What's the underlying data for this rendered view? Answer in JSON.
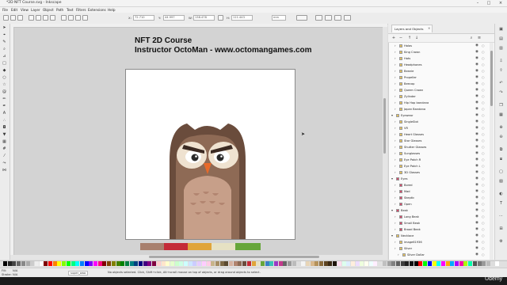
{
  "window": {
    "title": "*2D NFT Course.svg - Inkscape"
  },
  "menu": [
    "File",
    "Edit",
    "View",
    "Layer",
    "Object",
    "Path",
    "Text",
    "Filters",
    "Extensions",
    "Help"
  ],
  "toolbar": {
    "x_label": "X:",
    "x_value": "72.710",
    "y_label": "Y:",
    "y_value": "44.997",
    "w_label": "W:",
    "w_value": "138.478",
    "h_label": "H:",
    "h_value": "111.443",
    "unit": "mm"
  },
  "canvas": {
    "line1": "NFT 2D Course",
    "line2": "Instructor OctoMan - www.octomangames.com"
  },
  "palette_swatches": [
    {
      "name": "Brown",
      "color": "#a8806e"
    },
    {
      "name": "Red",
      "color": "#c42b37"
    },
    {
      "name": "Orange",
      "color": "#e0a43a"
    },
    {
      "name": "Cream",
      "color": "#e6e1c3"
    },
    {
      "name": "Green",
      "color": "#67a63a"
    }
  ],
  "panel": {
    "tab": "Layers and Objects",
    "close_glyph": "×"
  },
  "layers": [
    {
      "name": "Halos",
      "depth": 2,
      "color": "#e7c35b"
    },
    {
      "name": "King Crown",
      "depth": 2,
      "color": "#e7c35b"
    },
    {
      "name": "Hats",
      "depth": 2,
      "color": "#e7c35b"
    },
    {
      "name": "Headphones",
      "depth": 2,
      "color": "#e7c35b"
    },
    {
      "name": "Beanie",
      "depth": 2,
      "color": "#e7c35b"
    },
    {
      "name": "Propeller",
      "depth": 2,
      "color": "#e7c35b"
    },
    {
      "name": "Beecap",
      "depth": 2,
      "color": "#e7c35b"
    },
    {
      "name": "Queen Crown",
      "depth": 2,
      "color": "#e7c35b"
    },
    {
      "name": "Zylinder",
      "depth": 2,
      "color": "#e7c35b"
    },
    {
      "name": "Hip Hop bandana",
      "depth": 2,
      "color": "#e7c35b"
    },
    {
      "name": "Japan Bandana",
      "depth": 2,
      "color": "#e7c35b"
    },
    {
      "name": "Eyewear",
      "depth": 1,
      "color": "#e7c35b"
    },
    {
      "name": "SingleSlot",
      "depth": 2,
      "color": "#e7c35b"
    },
    {
      "name": "VR",
      "depth": 2,
      "color": "#e7c35b"
    },
    {
      "name": "Heart Glasses",
      "depth": 2,
      "color": "#e7c35b"
    },
    {
      "name": "Star Glasses",
      "depth": 2,
      "color": "#e7c35b"
    },
    {
      "name": "Shutter Glasses",
      "depth": 2,
      "color": "#e7c35b"
    },
    {
      "name": "Sunglasses",
      "depth": 2,
      "color": "#e7c35b"
    },
    {
      "name": "Eye Patch R",
      "depth": 2,
      "color": "#e7c35b"
    },
    {
      "name": "Eye Patch L",
      "depth": 2,
      "color": "#e7c35b"
    },
    {
      "name": "3D Glasses",
      "depth": 2,
      "color": "#e7c35b"
    },
    {
      "name": "Eyes",
      "depth": 1,
      "color": "#d24a6a"
    },
    {
      "name": "Bored",
      "depth": 2,
      "color": "#d24a6a"
    },
    {
      "name": "Mad",
      "depth": 2,
      "color": "#d24a6a"
    },
    {
      "name": "Skeptic",
      "depth": 2,
      "color": "#d24a6a"
    },
    {
      "name": "Open",
      "depth": 2,
      "color": "#d24a6a"
    },
    {
      "name": "Beak",
      "depth": 1,
      "color": "#d24a6a"
    },
    {
      "name": "Long Beak",
      "depth": 2,
      "color": "#d24a6a"
    },
    {
      "name": "Small Beak",
      "depth": 2,
      "color": "#d24a6a"
    },
    {
      "name": "Broad Beak",
      "depth": 2,
      "color": "#d24a6a"
    },
    {
      "name": "Necklace",
      "depth": 1,
      "color": "#e7c35b"
    },
    {
      "name": "image61936",
      "depth": 2,
      "color": "#e7c35b"
    },
    {
      "name": "Silver",
      "depth": 2,
      "color": "#e7c35b"
    },
    {
      "name": "Silver Dollar",
      "depth": 3,
      "color": "#e7c35b"
    }
  ],
  "status": {
    "fill_label": "Fill:",
    "fill_value": "N/A",
    "stroke_label": "Stroke:",
    "stroke_value": "N/A",
    "layer_label": "super_owo",
    "message": "No objects selected. Click, Shift+click, Alt+scroll mouse on top of objects, or drag around objects to select."
  },
  "watermark": "Udemy"
}
